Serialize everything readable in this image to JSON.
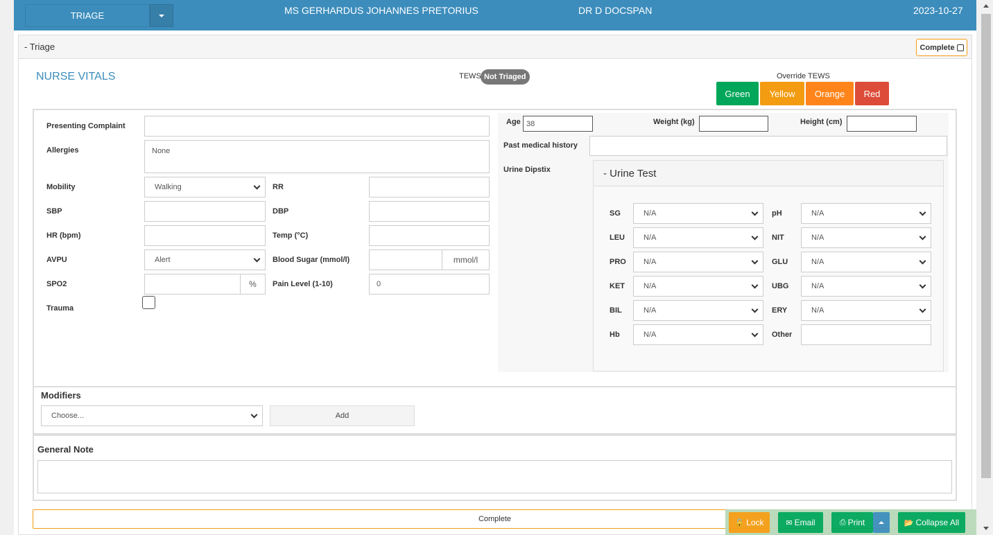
{
  "header": {
    "section_button": "TRIAGE",
    "patient_name": "MS GERHARDUS JOHANNES PRETORIUS",
    "doctor": "DR D DOCSPAN",
    "date": "2023-10-27"
  },
  "panel": {
    "title": "- Triage",
    "complete_label": "Complete"
  },
  "vitals": {
    "heading": "NURSE VITALS",
    "tews_label": "TEWS",
    "tews_status": "Not Triaged",
    "override_label": "Override TEWS",
    "override_buttons": [
      {
        "label": "Green",
        "color": "#00a65a"
      },
      {
        "label": "Yellow",
        "color": "#f39c12"
      },
      {
        "label": "Orange",
        "color": "#ff851b"
      },
      {
        "label": "Red",
        "color": "#dd4b39"
      }
    ]
  },
  "form": {
    "presenting_complaint": {
      "label": "Presenting Complaint",
      "value": ""
    },
    "allergies": {
      "label": "Allergies",
      "value": "None"
    },
    "mobility": {
      "label": "Mobility",
      "value": "Walking"
    },
    "rr": {
      "label": "RR",
      "value": ""
    },
    "sbp": {
      "label": "SBP",
      "value": ""
    },
    "dbp": {
      "label": "DBP",
      "value": ""
    },
    "hr": {
      "label": "HR (bpm)",
      "value": ""
    },
    "temp": {
      "label": "Temp (°C)",
      "value": ""
    },
    "avpu": {
      "label": "AVPU",
      "value": "Alert"
    },
    "blood_sugar": {
      "label": "Blood Sugar (mmol/l)",
      "value": "",
      "unit": "mmol/l"
    },
    "spo2": {
      "label": "SPO2",
      "value": "",
      "unit": "%"
    },
    "pain": {
      "label": "Pain Level (1-10)",
      "value": "0"
    },
    "trauma": {
      "label": "Trauma",
      "checked": false
    },
    "age": {
      "label": "Age",
      "value": "38"
    },
    "weight": {
      "label": "Weight (kg)",
      "value": ""
    },
    "height": {
      "label": "Height (cm)",
      "value": ""
    },
    "past_history": {
      "label": "Past medical history",
      "value": ""
    },
    "urine_dipstix": {
      "label": "Urine Dipstix"
    }
  },
  "urine": {
    "title": "- Urine Test",
    "left": [
      {
        "label": "SG",
        "value": "N/A"
      },
      {
        "label": "LEU",
        "value": "N/A"
      },
      {
        "label": "PRO",
        "value": "N/A"
      },
      {
        "label": "KET",
        "value": "N/A"
      },
      {
        "label": "BIL",
        "value": "N/A"
      },
      {
        "label": "Hb",
        "value": "N/A"
      }
    ],
    "right": [
      {
        "label": "pH",
        "value": "N/A"
      },
      {
        "label": "NIT",
        "value": "N/A"
      },
      {
        "label": "GLU",
        "value": "N/A"
      },
      {
        "label": "UBG",
        "value": "N/A"
      },
      {
        "label": "ERY",
        "value": "N/A"
      },
      {
        "label": "Other",
        "value": ""
      }
    ]
  },
  "modifiers": {
    "label": "Modifiers",
    "placeholder": "Choose...",
    "add_button": "Add"
  },
  "general_note": {
    "label": "General Note",
    "value": ""
  },
  "complete_bar": "Complete",
  "footer": {
    "lock": "Lock",
    "email": "Email",
    "print": "Print",
    "collapse_all": "Collapse All"
  }
}
